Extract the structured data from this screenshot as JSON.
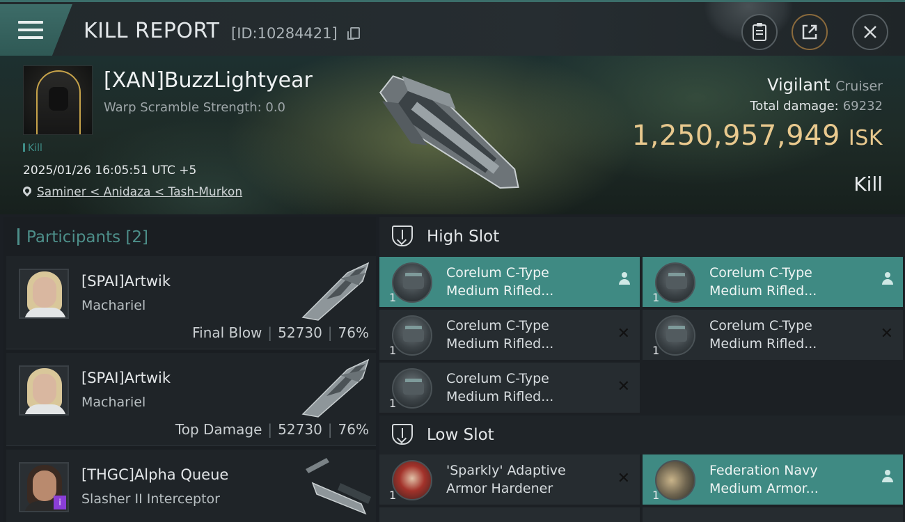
{
  "header": {
    "title": "KILL REPORT",
    "report_id": "[ID:10284421]"
  },
  "victim": {
    "name": "[XAN]BuzzLightyear",
    "scramble": "Warp Scramble Strength: 0.0",
    "tag": "Kill",
    "datetime": "2025/01/26 16:05:51 UTC +5",
    "location": "Saminer < Anidaza < Tash-Murkon",
    "ship_name": "Vigilant",
    "ship_class": "Cruiser",
    "total_damage_label": "Total damage:",
    "total_damage": "69232",
    "isk_value": "1,250,957,949",
    "isk_unit": "ISK",
    "result": "Kill"
  },
  "participants": {
    "label": "Participants",
    "count": "[2]",
    "rows": [
      {
        "name": "[SPAI]Artwik",
        "ship": "Machariel",
        "role": "Final Blow",
        "damage": "52730",
        "percent": "76%"
      },
      {
        "name": "[SPAI]Artwik",
        "ship": "Machariel",
        "role": "Top Damage",
        "damage": "52730",
        "percent": "76%"
      },
      {
        "name": "[THGC]Alpha Queue",
        "ship": "Slasher II Interceptor",
        "badge": "i"
      }
    ]
  },
  "slots": {
    "high": {
      "label": "High Slot",
      "items": [
        {
          "line1": "Corelum C-Type",
          "line2": "Medium Rifled...",
          "qty": "1",
          "status": "dropped"
        },
        {
          "line1": "Corelum C-Type",
          "line2": "Medium Rifled...",
          "qty": "1",
          "status": "dropped"
        },
        {
          "line1": "Corelum C-Type",
          "line2": "Medium Rifled...",
          "qty": "1",
          "status": "destroyed"
        },
        {
          "line1": "Corelum C-Type",
          "line2": "Medium Rifled...",
          "qty": "1",
          "status": "destroyed"
        },
        {
          "line1": "Corelum C-Type",
          "line2": "Medium Rifled...",
          "qty": "1",
          "status": "destroyed"
        }
      ]
    },
    "low": {
      "label": "Low Slot",
      "items": [
        {
          "line1": "'Sparkly' Adaptive",
          "line2": "Armor Hardener",
          "qty": "1",
          "status": "destroyed"
        },
        {
          "line1": "Federation Navy",
          "line2": "Medium Armor...",
          "qty": "1",
          "status": "dropped"
        }
      ]
    }
  },
  "colors": {
    "accent_teal": "#3f8a83",
    "isk_gold": "#e9c98e",
    "text_muted": "#9ea6a9"
  },
  "icons": {
    "menu": "hamburger-icon",
    "clipboard": "clipboard-icon",
    "share": "share-icon",
    "close": "close-icon",
    "copy": "copy-icon",
    "location": "location-pin-icon",
    "slot": "shield-icon",
    "dropped": "person-icon",
    "destroyed": "x-icon"
  }
}
